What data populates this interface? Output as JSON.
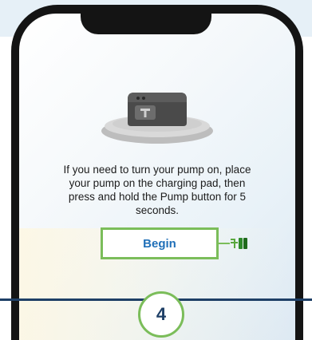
{
  "instruction_text": "If you need to turn your pump on, place your pump on the charging pad, then press and hold the Pump button for 5 seconds.",
  "begin_button_label": "Begin",
  "step_number": "4",
  "icons": {
    "pump": "pump-on-charging-pad-icon",
    "tap": "tap-indicator-icon"
  },
  "colors": {
    "accent_green": "#7bbd5a",
    "button_text_blue": "#1f6fb8",
    "navy": "#1e3f66",
    "phone_frame": "#141414"
  }
}
